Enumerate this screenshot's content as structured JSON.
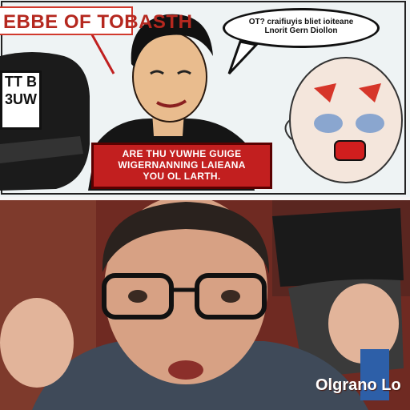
{
  "top_panel": {
    "title": "EBBE OF TOBASTH",
    "speech_bubble_lines": [
      "OT? craifiuyis bliet ioiteane",
      "Lnorit Gern Diollon"
    ],
    "sign_lines": [
      "TT B",
      "3UW"
    ],
    "caption_lines": [
      "ARE THU YUWHE GUIGE",
      "WIGERNANNING LAIEANA",
      "YOU OL LARTH."
    ]
  },
  "bottom_panel": {
    "watermark": "Olgrano Lo"
  },
  "colors": {
    "title_red": "#b5281f",
    "caption_red": "#c21f1f",
    "background_red": "#7a2b22"
  }
}
